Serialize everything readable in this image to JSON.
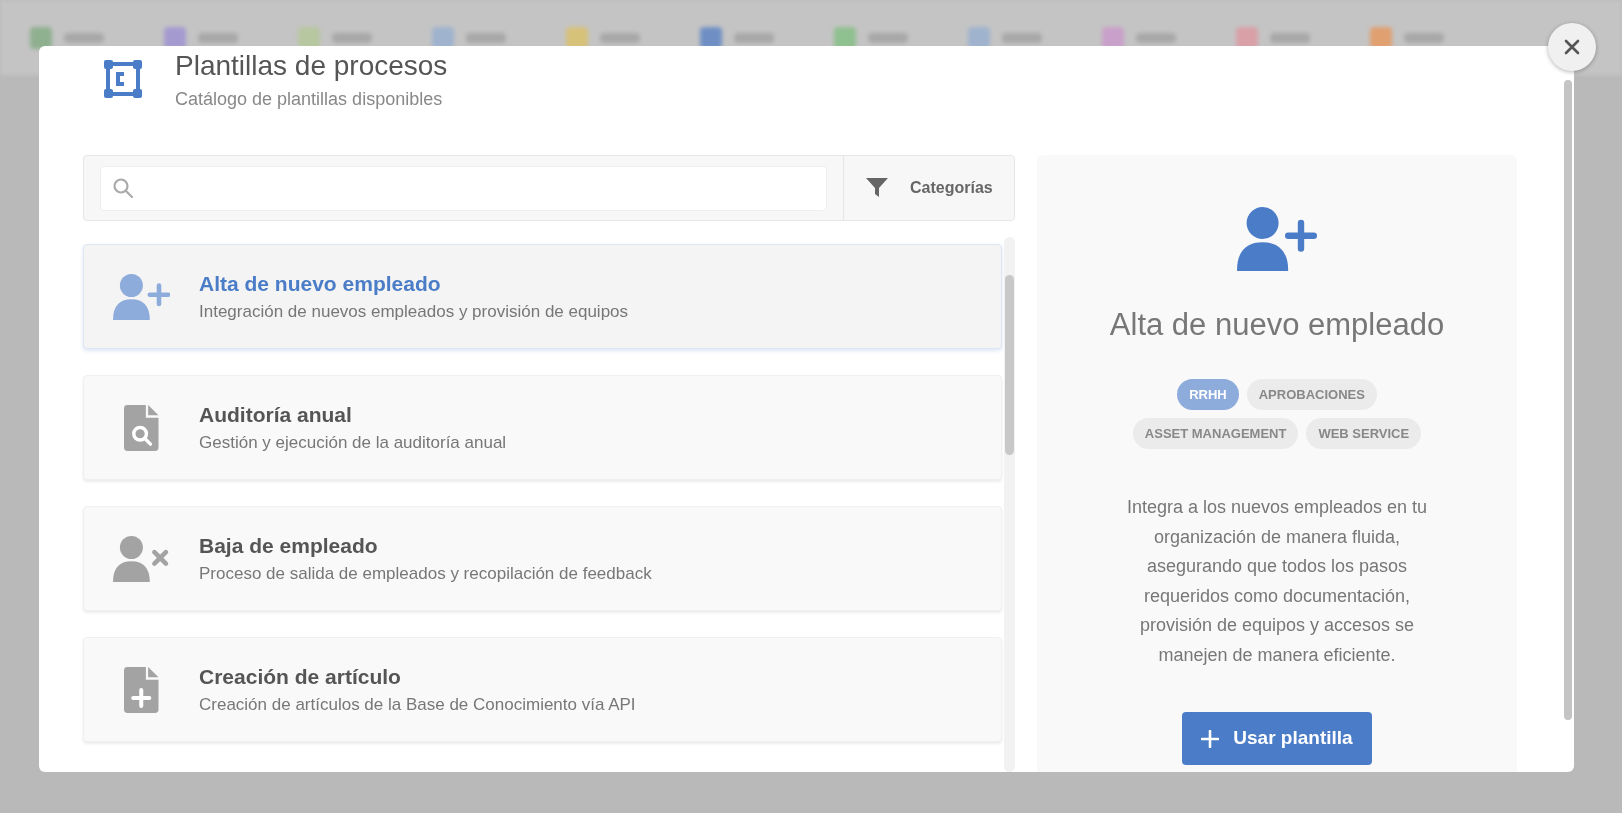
{
  "dialog": {
    "title": "Plantillas de procesos",
    "subtitle": "Catálogo de plantillas disponibles"
  },
  "filter_button": {
    "label": "Categorías"
  },
  "templates": [
    {
      "title": "Alta de nuevo empleado",
      "description": "Integración de nuevos empleados y provisión de equipos",
      "kind": "adduser",
      "selected": true
    },
    {
      "title": "Auditoría anual",
      "description": "Gestión y ejecución de la auditoría anual",
      "kind": "audit",
      "selected": false
    },
    {
      "title": "Baja de empleado",
      "description": "Proceso de salida de empleados y recopilación de feedback",
      "kind": "removeuser",
      "selected": false
    },
    {
      "title": "Creación de artículo",
      "description": "Creación de artículos de la Base de Conocimiento vía API",
      "kind": "newfile",
      "selected": false
    }
  ],
  "detail": {
    "kind": "adduser",
    "title": "Alta de nuevo empleado",
    "tags": [
      {
        "label": "RRHH",
        "selected": true
      },
      {
        "label": "APROBACIONES",
        "selected": false
      },
      {
        "label": "ASSET MANAGEMENT",
        "selected": false
      },
      {
        "label": "WEB SERVICE",
        "selected": false
      }
    ],
    "description": "Integra a los nuevos empleados en tu organización de manera fluida, asegurando que todos los pasos requeridos como documentación, provisión de equipos y accesos se manejen de manera eficiente.",
    "button": {
      "label": "Usar plantilla"
    }
  }
}
